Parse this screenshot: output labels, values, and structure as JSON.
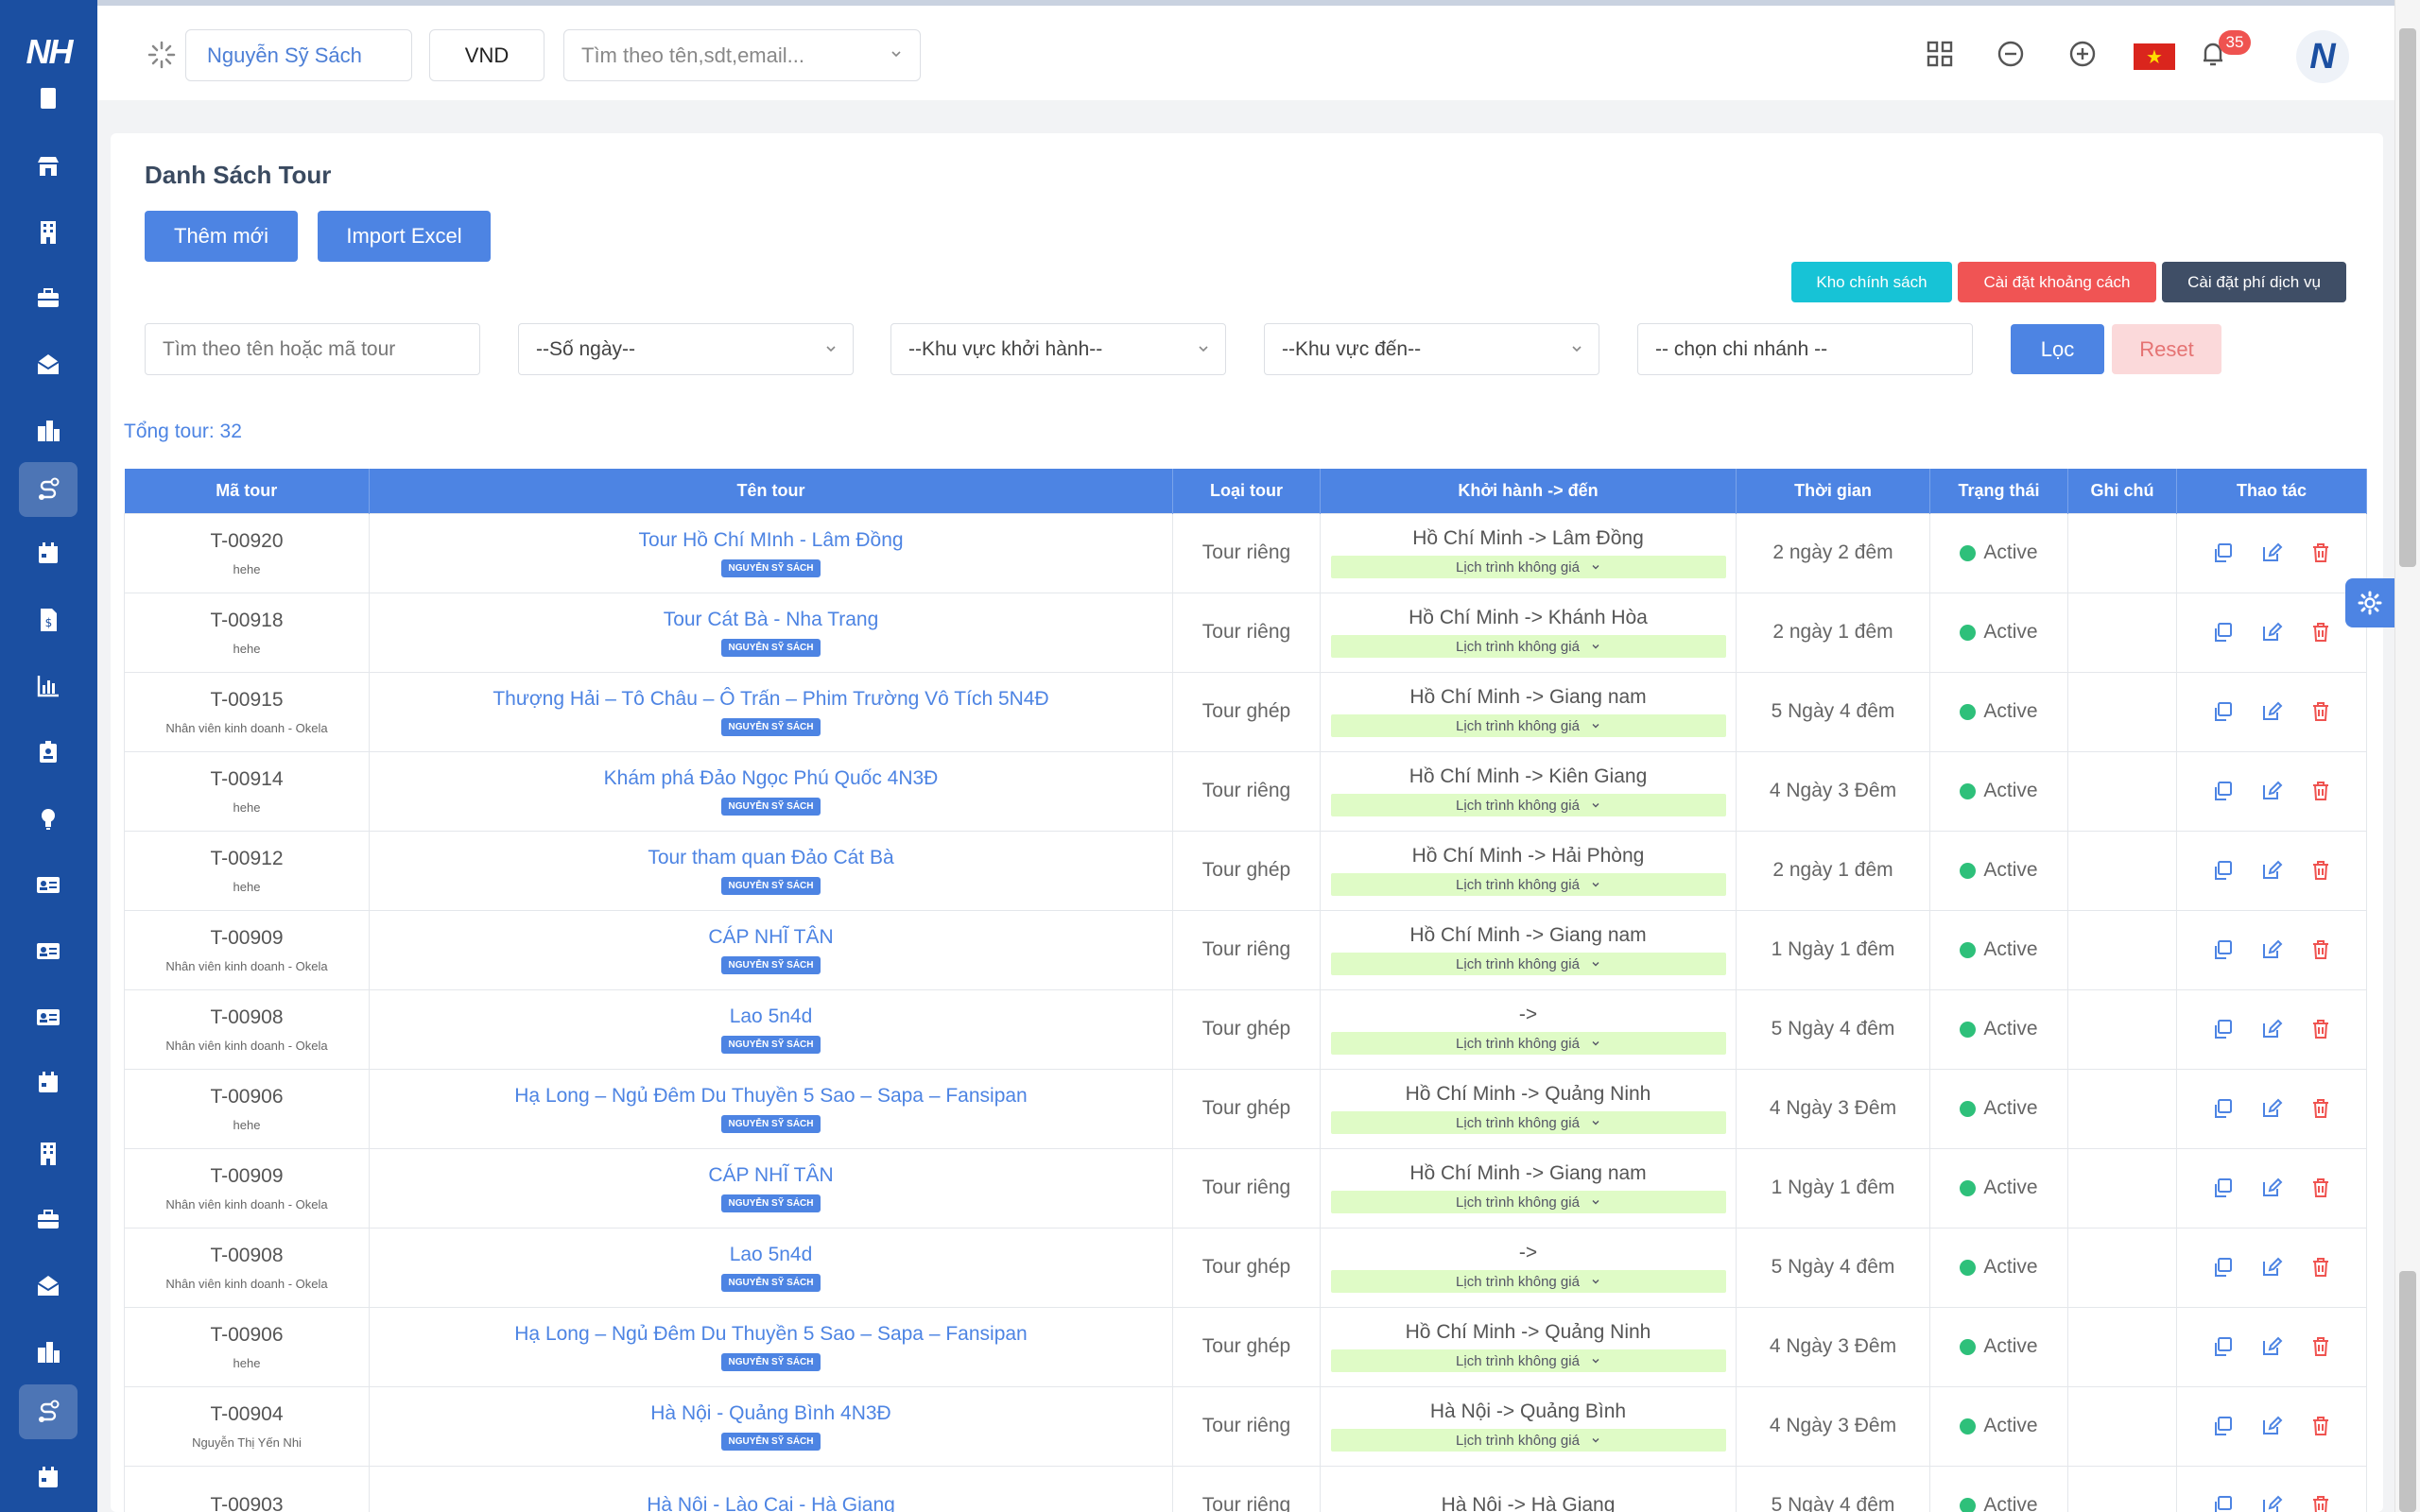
{
  "header": {
    "store_name": "Nguyễn Sỹ Sách",
    "currency": "VND",
    "search_placeholder": "Tìm theo tên,sdt,email...",
    "notification_count": "35",
    "flag_star": "★",
    "avatar_letter": "N",
    "logo_text": "NH"
  },
  "page": {
    "title": "Danh Sách Tour",
    "add_button": "Thêm mới",
    "import_button": "Import Excel",
    "policy_button": "Kho chính sách",
    "distance_button": "Cài đặt khoảng cách",
    "service_fee_button": "Cài đặt phí dịch vụ",
    "total_label": "Tổng tour: 32"
  },
  "filters": {
    "search_placeholder": "Tìm theo tên hoặc mã tour",
    "days": "--Số ngày--",
    "departure_region": "--Khu vực khởi hành--",
    "destination_region": "--Khu vực đến--",
    "branch": "-- chọn chi nhánh --",
    "filter_button": "Lọc",
    "reset_button": "Reset"
  },
  "table": {
    "headers": [
      "Mã tour",
      "Tên tour",
      "Loại tour",
      "Khởi hành -> đến",
      "Thời gian",
      "Trạng thái",
      "Ghi chú",
      "Thao tác"
    ],
    "rows": [
      {
        "code": "T-00920",
        "staff": "hehe",
        "name": "Tour Hồ Chí MInh - Lâm Đồng",
        "tag": "NGUYỄN SỸ SÁCH",
        "type": "Tour riêng",
        "route": "Hồ Chí Minh -> Lâm Đồng",
        "schedule": "Lịch trình không giá",
        "duration": "2 ngày 2 đêm",
        "status": "Active",
        "note": ""
      },
      {
        "code": "T-00918",
        "staff": "hehe",
        "name": "Tour Cát Bà - Nha Trang",
        "tag": "NGUYỄN SỸ SÁCH",
        "type": "Tour riêng",
        "route": "Hồ Chí Minh -> Khánh Hòa",
        "schedule": "Lịch trình không giá",
        "duration": "2 ngày 1 đêm",
        "status": "Active",
        "note": ""
      },
      {
        "code": "T-00915",
        "staff": "Nhân viên kinh doanh - Okela",
        "name": "Thượng Hải – Tô Châu – Ô Trấn – Phim Trường Vô Tích 5N4Đ",
        "tag": "NGUYỄN SỸ SÁCH",
        "type": "Tour ghép",
        "route": "Hồ Chí Minh -> Giang nam",
        "schedule": "Lịch trình không giá",
        "duration": "5 Ngày 4 đêm",
        "status": "Active",
        "note": ""
      },
      {
        "code": "T-00914",
        "staff": "hehe",
        "name": "Khám phá Đảo Ngọc Phú Quốc 4N3Đ",
        "tag": "NGUYỄN SỸ SÁCH",
        "type": "Tour riêng",
        "route": "Hồ Chí Minh -> Kiên Giang",
        "schedule": "Lịch trình không giá",
        "duration": "4 Ngày 3 Đêm",
        "status": "Active",
        "note": ""
      },
      {
        "code": "T-00912",
        "staff": "hehe",
        "name": "Tour tham quan Đảo Cát Bà",
        "tag": "NGUYỄN SỸ SÁCH",
        "type": "Tour ghép",
        "route": "Hồ Chí Minh -> Hải Phòng",
        "schedule": "Lịch trình không giá",
        "duration": "2 ngày 1 đêm",
        "status": "Active",
        "note": ""
      },
      {
        "code": "T-00909",
        "staff": "Nhân viên kinh doanh - Okela",
        "name": "CÁP NHĨ TÂN",
        "tag": "NGUYỄN SỸ SÁCH",
        "type": "Tour riêng",
        "route": "Hồ Chí Minh -> Giang nam",
        "schedule": "Lịch trình không giá",
        "duration": "1 Ngày 1 đêm",
        "status": "Active",
        "note": ""
      },
      {
        "code": "T-00908",
        "staff": "Nhân viên kinh doanh - Okela",
        "name": "Lao 5n4d",
        "tag": "NGUYỄN SỸ SÁCH",
        "type": "Tour ghép",
        "route": "->",
        "schedule": "Lịch trình không giá",
        "duration": "5 Ngày 4 đêm",
        "status": "Active",
        "note": ""
      },
      {
        "code": "T-00906",
        "staff": "hehe",
        "name": "Hạ Long – Ngủ Đêm Du Thuyền 5 Sao – Sapa – Fansipan",
        "tag": "NGUYỄN SỸ SÁCH",
        "type": "Tour ghép",
        "route": "Hồ Chí Minh -> Quảng Ninh",
        "schedule": "Lịch trình không giá",
        "duration": "4 Ngày 3 Đêm",
        "status": "Active",
        "note": ""
      },
      {
        "code": "T-00909",
        "staff": "Nhân viên kinh doanh - Okela",
        "name": "CÁP NHĨ TÂN",
        "tag": "NGUYỄN SỸ SÁCH",
        "type": "Tour riêng",
        "route": "Hồ Chí Minh -> Giang nam",
        "schedule": "Lịch trình không giá",
        "duration": "1 Ngày 1 đêm",
        "status": "Active",
        "note": ""
      },
      {
        "code": "T-00908",
        "staff": "Nhân viên kinh doanh - Okela",
        "name": "Lao 5n4d",
        "tag": "NGUYỄN SỸ SÁCH",
        "type": "Tour ghép",
        "route": "->",
        "schedule": "Lịch trình không giá",
        "duration": "5 Ngày 4 đêm",
        "status": "Active",
        "note": ""
      },
      {
        "code": "T-00906",
        "staff": "hehe",
        "name": "Hạ Long – Ngủ Đêm Du Thuyền 5 Sao – Sapa – Fansipan",
        "tag": "NGUYỄN SỸ SÁCH",
        "type": "Tour ghép",
        "route": "Hồ Chí Minh -> Quảng Ninh",
        "schedule": "Lịch trình không giá",
        "duration": "4 Ngày 3 Đêm",
        "status": "Active",
        "note": ""
      },
      {
        "code": "T-00904",
        "staff": "Nguyễn Thị Yến Nhi",
        "name": "Hà Nội - Quảng Bình 4N3Đ",
        "tag": "NGUYỄN SỸ SÁCH",
        "type": "Tour riêng",
        "route": "Hà Nội -> Quảng Bình",
        "schedule": "Lịch trình không giá",
        "duration": "4 Ngày 3 Đêm",
        "status": "Active",
        "note": ""
      },
      {
        "code": "T-00903",
        "staff": "",
        "name": "Hà Nội - Lào Cai - Hà Giang",
        "tag": "",
        "type": "Tour riêng",
        "route": "Hà Nội -> Hà Giang",
        "schedule": "",
        "duration": "5 Ngày 4 đêm",
        "status": "Active",
        "note": ""
      }
    ]
  },
  "sidebar": {
    "icons": [
      "receipt-icon",
      "store-icon",
      "building-icon",
      "briefcase-icon",
      "mail-open-icon",
      "city-icon",
      "route-icon",
      "calendar-icon",
      "invoice-icon",
      "chart-icon",
      "id-badge-icon",
      "lightbulb-icon",
      "id-card-icon",
      "id-card-icon",
      "id-card-icon",
      "calendar-icon",
      "building-icon",
      "briefcase-icon",
      "mail-open-icon",
      "city-icon",
      "route-icon",
      "calendar-icon"
    ],
    "active_index": [
      6,
      20
    ]
  },
  "colors": {
    "sidebar": "#1b4fa1",
    "primary": "#4d84e3",
    "policy": "#17c3d6",
    "distance": "#f05454",
    "service_fee": "#3f4e66",
    "reset_bg": "#fbd9da",
    "reset_text": "#e57373",
    "active_dot": "#2ec07a",
    "schedule_bg": "#dffbc6",
    "delete": "#ef5350"
  }
}
